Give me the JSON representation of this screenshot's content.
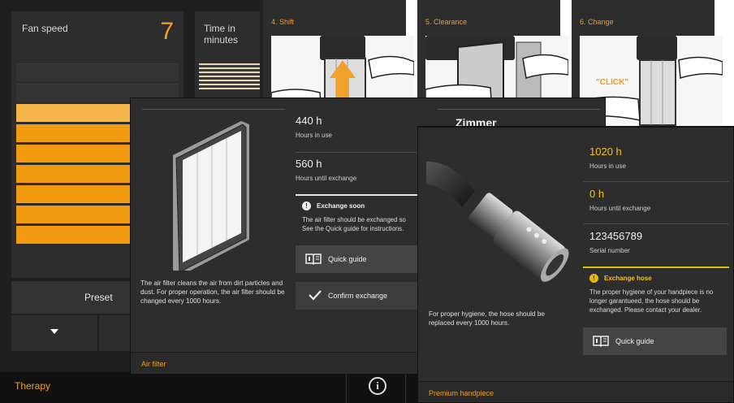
{
  "fan": {
    "label": "Fan speed",
    "value": "7",
    "level": 7,
    "max": 9
  },
  "time": {
    "label_line1": "Time in",
    "label_line2": "minutes"
  },
  "preset": {
    "label": "Preset"
  },
  "bottom": {
    "therapy": "Therapy",
    "info_glyph": "i"
  },
  "guide": {
    "steps": [
      {
        "title": "4. Shift"
      },
      {
        "title": "5. Clearance"
      },
      {
        "title": "6. Change",
        "callout": "\"CLICK\""
      }
    ]
  },
  "air_filter": {
    "title": "Zimmer",
    "hours_in_use_value": "440 h",
    "hours_in_use_label": "Hours in use",
    "hours_until_value": "560 h",
    "hours_until_label": "Hours until exchange",
    "warning_title": "Exchange soon",
    "warning_line1": "The air filter should be exchanged so",
    "warning_line2": "See the Quick guide for instructions.",
    "quick_guide_label": "Quick guide",
    "confirm_label": "Confirm exchange",
    "description": "The air filter cleans the air from dirt particles and dust. For proper operation, the air filter should be changed every 1000 hours.",
    "footer": "Air filter"
  },
  "handpiece": {
    "hours_in_use_value": "1020 h",
    "hours_in_use_label": "Hours in use",
    "hours_until_value": "0 h",
    "hours_until_label": "Hours until exchange",
    "serial_value": "123456789",
    "serial_label": "Serial number",
    "warning_title": "Exchange hose",
    "warning_text": "The proper hygiene of your handpiece is no longer garantueed, the hose should be exchanged. Please contact your dealer.",
    "quick_guide_label": "Quick guide",
    "description": "For proper hygiene, the hose should be replaced every 1000 hours.",
    "footer": "Premium handpiece"
  },
  "colors": {
    "accent": "#f0a020",
    "warning": "#f5c21a",
    "panel": "#2d2d2d"
  },
  "icons": [
    "chevron-down-icon",
    "info-icon",
    "book-icon",
    "check-icon",
    "warning-icon"
  ]
}
